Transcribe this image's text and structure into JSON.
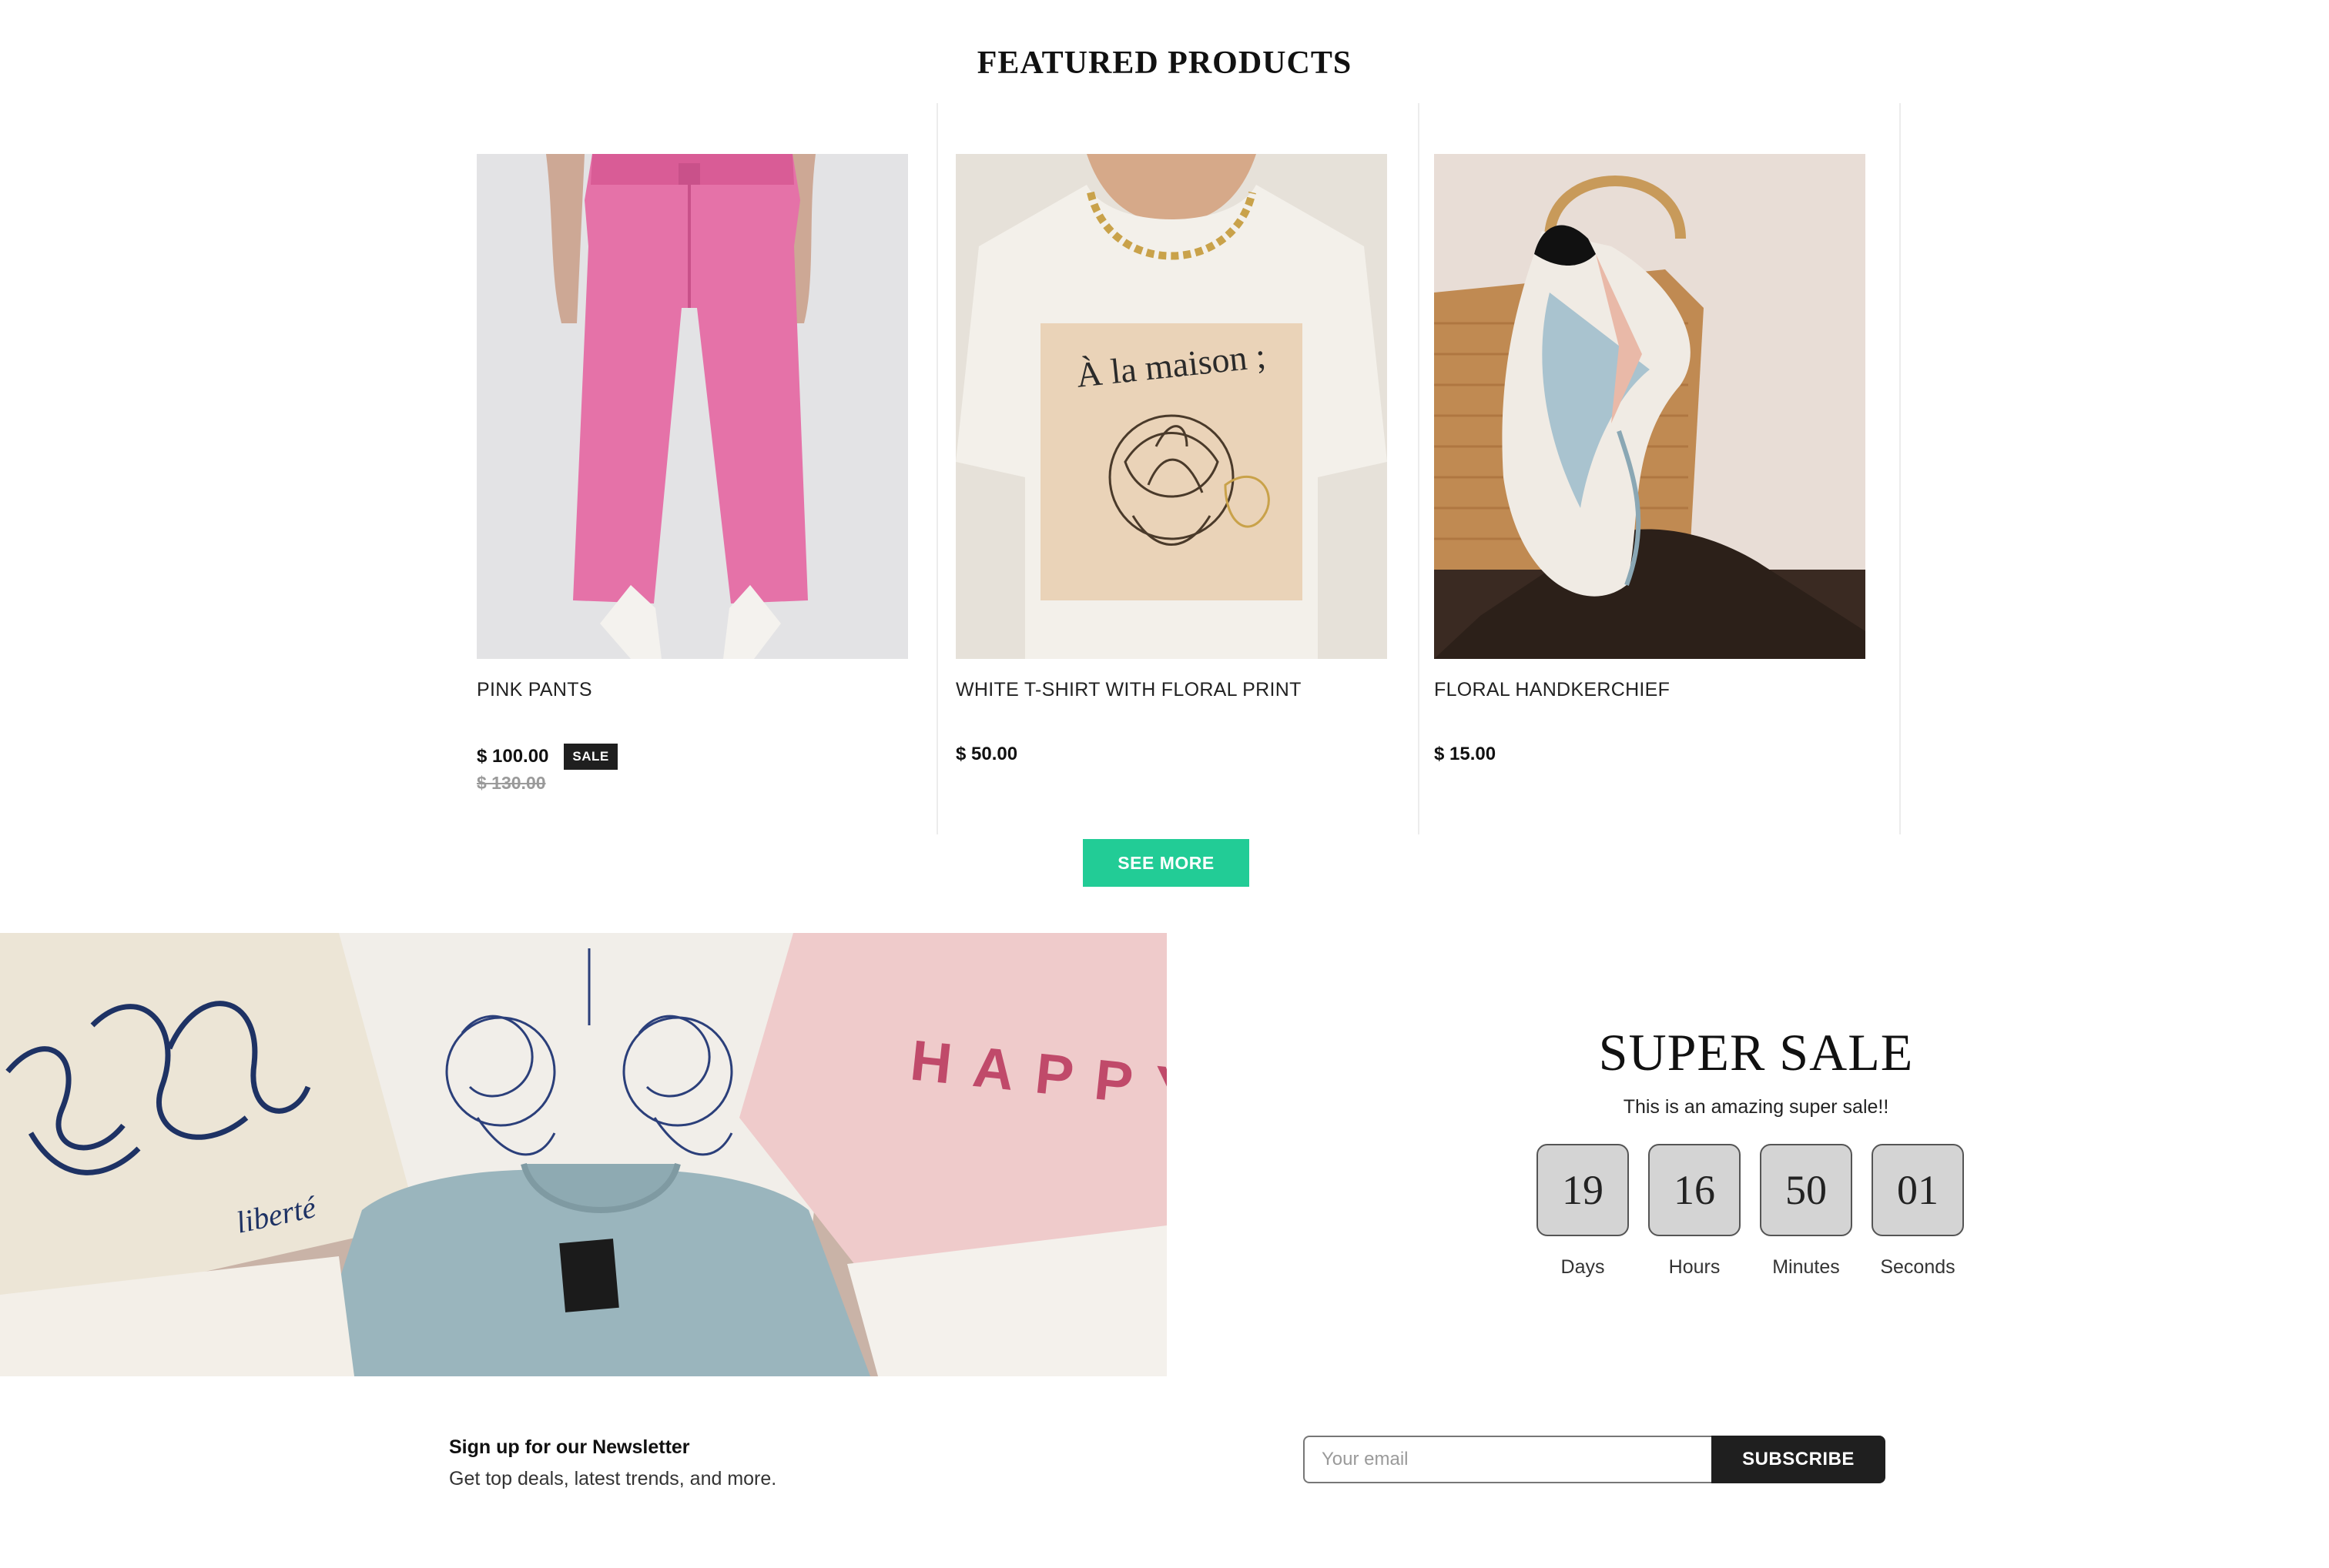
{
  "featured": {
    "title": "FEATURED PRODUCTS",
    "see_more_label": "SEE MORE",
    "products": [
      {
        "name": "PINK PANTS",
        "price": "$ 100.00",
        "badge": "SALE",
        "old_price": "$ 130.00",
        "image_icon": "pink-pants-photo"
      },
      {
        "name": "WHITE T-SHIRT WITH FLORAL PRINT",
        "price": "$ 50.00",
        "image_icon": "white-tshirt-photo",
        "shirt_print": "À la maison ;"
      },
      {
        "name": "FLORAL HANDKERCHIEF",
        "price": "$ 15.00",
        "image_icon": "floral-handkerchief-photo"
      }
    ]
  },
  "banner": {
    "image_icon": "folded-tshirts-photo",
    "print_happy": "HAPPY",
    "print_liberte": "liberté"
  },
  "super_sale": {
    "title": "SUPER SALE",
    "subtitle": "This is an amazing super sale!!",
    "countdown": [
      {
        "value": "19",
        "label": "Days"
      },
      {
        "value": "16",
        "label": "Hours"
      },
      {
        "value": "50",
        "label": "Minutes"
      },
      {
        "value": "01",
        "label": "Seconds"
      }
    ]
  },
  "newsletter": {
    "title": "Sign up for our Newsletter",
    "subtitle": "Get top deals, latest trends, and more.",
    "email_placeholder": "Your email",
    "subscribe_label": "SUBSCRIBE"
  },
  "colors": {
    "accent": "#22cc96",
    "dark": "#1f1f1f",
    "countdown_bg": "#d4d4d4"
  }
}
